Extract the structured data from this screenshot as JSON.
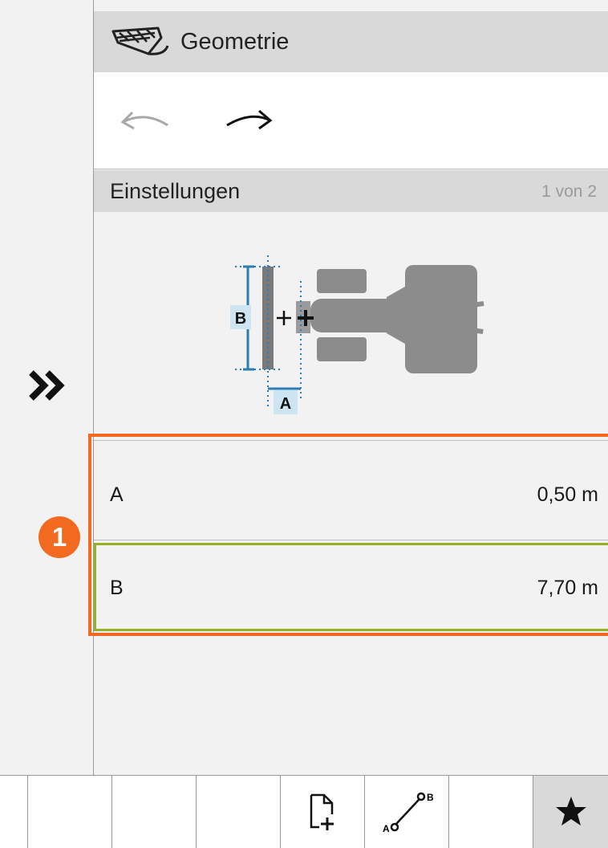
{
  "header": {
    "title": "Geometrie",
    "logo_icon": "spreader-boom-icon"
  },
  "history": {
    "undo_icon": "undo-arrow-icon",
    "redo_icon": "redo-arrow-icon"
  },
  "section": {
    "title": "Einstellungen",
    "page": "1 von 2"
  },
  "diagram": {
    "label_a": "A",
    "label_b": "B",
    "icon": "tractor-geometry-icon"
  },
  "params": [
    {
      "label": "A",
      "value": "0,50 m"
    },
    {
      "label": "B",
      "value": "7,70 m"
    }
  ],
  "callout": {
    "number": "1",
    "color": "#f26a1f"
  },
  "selection_color": "#96b02a",
  "toolbar": {
    "buttons": [
      "",
      "",
      "",
      "new-document-icon",
      "ab-line-icon",
      "",
      "favorite-star-icon"
    ],
    "ab_label_a": "A",
    "ab_label_b": "B"
  }
}
